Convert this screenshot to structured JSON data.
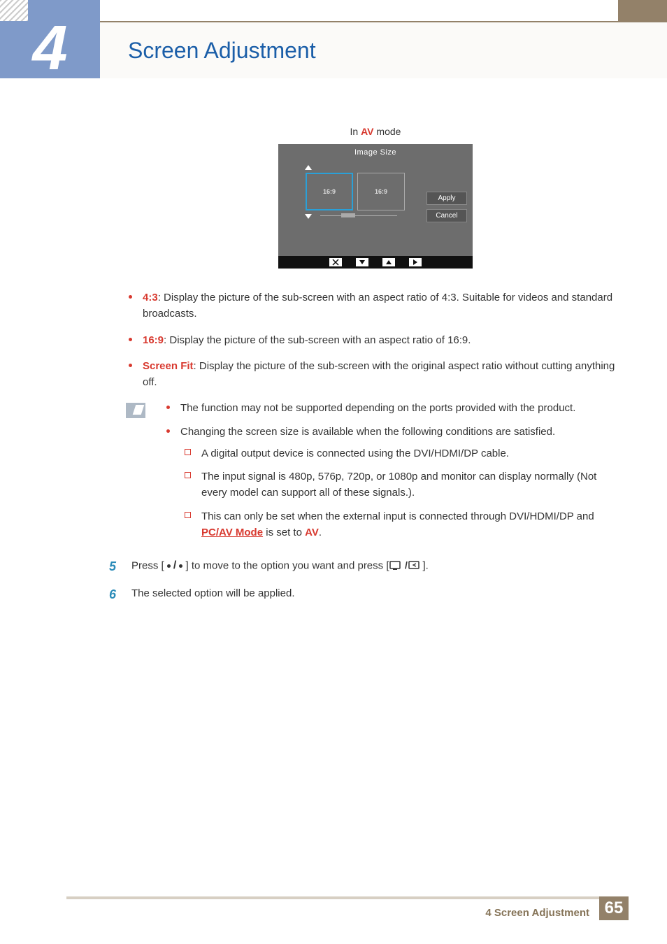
{
  "header": {
    "chapter_number": "4",
    "title": "Screen Adjustment"
  },
  "caption": {
    "prefix": "In ",
    "mode": "AV",
    "suffix": " mode"
  },
  "osd": {
    "title": "Image Size",
    "option_a": "16:9",
    "option_b": "16:9",
    "apply": "Apply",
    "cancel": "Cancel"
  },
  "bullets": {
    "b1_term": "4:3",
    "b1_text": ": Display the picture of the sub-screen with an aspect ratio of 4:3. Suitable for videos and standard broadcasts.",
    "b2_term": "16:9",
    "b2_text": ": Display the picture of the sub-screen with an aspect ratio of 16:9.",
    "b3_term": "Screen Fit",
    "b3_text": ": Display the picture of the sub-screen with the original aspect ratio without cutting anything off."
  },
  "notes": {
    "n1": "The function may not be supported depending on the ports provided with the product.",
    "n2": "Changing the screen size is available when the following conditions are satisfied.",
    "s1": "A digital output device is connected using the DVI/HDMI/DP cable.",
    "s2": "The input signal is 480p, 576p, 720p, or 1080p and monitor can display normally (Not every model can support all of these signals.).",
    "s3_a": "This can only be set when the external input is connected through DVI/HDMI/DP and ",
    "s3_link": "PC/AV Mode",
    "s3_b": " is set to ",
    "s3_c": "AV",
    "s3_d": "."
  },
  "steps": {
    "num5": "5",
    "num6": "6",
    "s5_a": "Press [ ",
    "s5_b": " ] to move to the option you want and press [",
    "s5_c": "].",
    "s6": "The selected option will be applied."
  },
  "footer": {
    "label": "4 Screen Adjustment",
    "page": "65"
  }
}
